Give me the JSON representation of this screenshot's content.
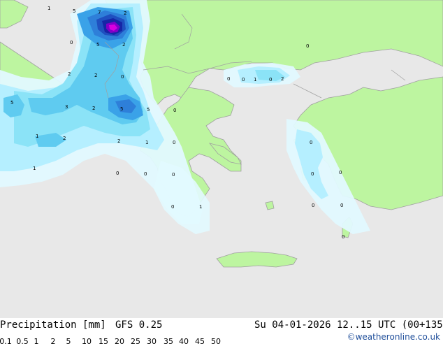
{
  "header": {
    "title_left": "Precipitation [mm]",
    "model": "GFS 0.25",
    "valid_time": "Su 04-01-2026 12..15 UTC (00+135)"
  },
  "credit": "©weatheronline.co.uk",
  "legend": {
    "ticks": [
      "0.1",
      "0.5",
      "1",
      "2",
      "5",
      "10",
      "15",
      "20",
      "25",
      "30",
      "35",
      "40",
      "45",
      "50"
    ],
    "colors": [
      "#ffffff",
      "#e2f9ff",
      "#b5efff",
      "#8be3f7",
      "#5fcbf0",
      "#3aa2e8",
      "#2e7fd9",
      "#1f50c0",
      "#1626a6",
      "#4a00b8",
      "#8000c8",
      "#b000d8",
      "#d800e0",
      "#f000f0"
    ]
  },
  "colors": {
    "sea": "#e8e8e8",
    "land": "#bdf5a0",
    "border": "#a0a0a0"
  },
  "map_labels": [
    {
      "id": "v1",
      "text": "1"
    },
    {
      "id": "v2",
      "text": "5"
    },
    {
      "id": "v3",
      "text": "7"
    },
    {
      "id": "v4",
      "text": "2"
    },
    {
      "id": "v5",
      "text": "5"
    },
    {
      "id": "v6",
      "text": "2"
    },
    {
      "id": "v7",
      "text": "0"
    },
    {
      "id": "v8",
      "text": "0"
    },
    {
      "id": "v9",
      "text": "2"
    },
    {
      "id": "v10",
      "text": "2"
    },
    {
      "id": "v11",
      "text": "0"
    },
    {
      "id": "v12",
      "text": "5"
    },
    {
      "id": "v13",
      "text": "3"
    },
    {
      "id": "v14",
      "text": "2"
    },
    {
      "id": "v15",
      "text": "5"
    },
    {
      "id": "v16",
      "text": "5"
    },
    {
      "id": "v17",
      "text": "0"
    },
    {
      "id": "v18",
      "text": "0"
    },
    {
      "id": "v19",
      "text": "1"
    },
    {
      "id": "v20",
      "text": "2"
    },
    {
      "id": "v21",
      "text": "0"
    },
    {
      "id": "v22",
      "text": "1"
    },
    {
      "id": "v23",
      "text": "2"
    },
    {
      "id": "v24",
      "text": "1"
    },
    {
      "id": "v25",
      "text": "2"
    },
    {
      "id": "v26",
      "text": "0"
    },
    {
      "id": "v27",
      "text": "1"
    },
    {
      "id": "v28",
      "text": "0"
    },
    {
      "id": "v29",
      "text": "0"
    },
    {
      "id": "v30",
      "text": "0"
    },
    {
      "id": "v31",
      "text": "0"
    },
    {
      "id": "v32",
      "text": "0"
    },
    {
      "id": "v33",
      "text": "0"
    },
    {
      "id": "v34",
      "text": "1"
    },
    {
      "id": "v35",
      "text": "0"
    },
    {
      "id": "v36",
      "text": "0"
    },
    {
      "id": "v37",
      "text": "0"
    },
    {
      "id": "v38",
      "text": "0"
    },
    {
      "id": "v39",
      "text": "0"
    }
  ]
}
